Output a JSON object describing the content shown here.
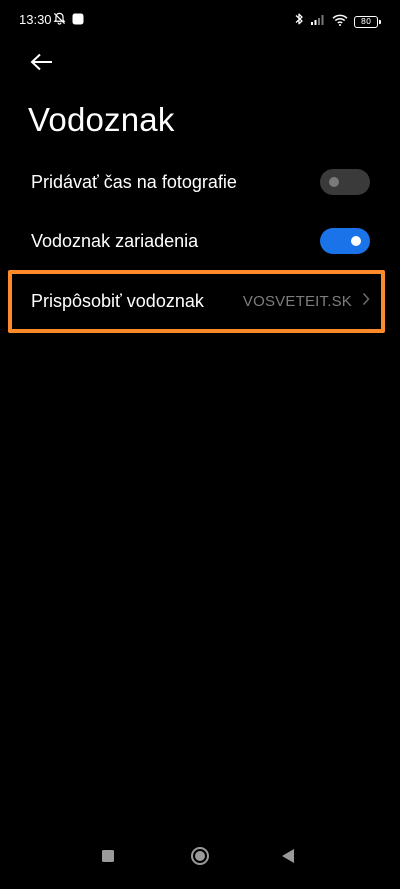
{
  "status_bar": {
    "time": "13:30",
    "battery_level": "80",
    "icons": [
      "bell-muted-icon",
      "app-notification-icon",
      "bluetooth-icon",
      "signal-icon",
      "wifi-icon",
      "battery-icon"
    ]
  },
  "header": {
    "back_icon": "arrow-left-icon",
    "title": "Vodoznak"
  },
  "settings": {
    "add_time": {
      "label": "Pridávať čas na fotografie",
      "enabled": false
    },
    "device_watermark": {
      "label": "Vodoznak zariadenia",
      "enabled": true
    },
    "customize": {
      "label": "Prispôsobiť vodoznak",
      "value": "VOSVETEIT.SK",
      "icon": "chevron-right-icon"
    }
  },
  "highlight": {
    "color": "#ff8a2a"
  },
  "colors": {
    "background": "#000000",
    "toggle_on": "#1a73e8",
    "toggle_off": "#3a3a3a",
    "secondary_text": "#7d7d7d"
  },
  "nav_bar": {
    "icons": [
      "recents-square-icon",
      "home-circle-icon",
      "back-triangle-icon"
    ]
  }
}
